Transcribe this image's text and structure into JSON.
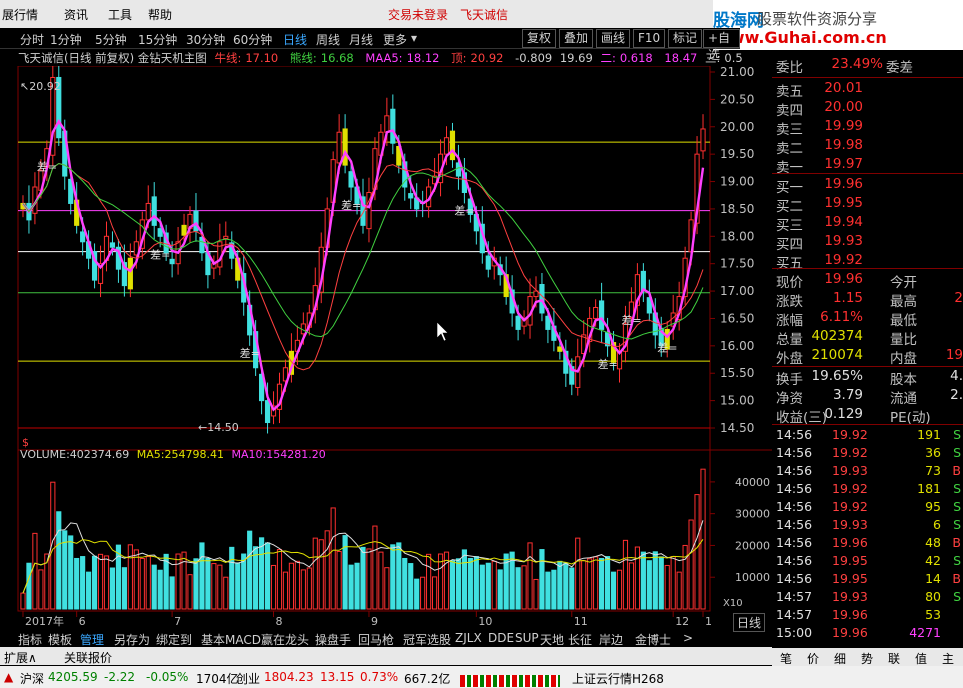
{
  "menubar": {
    "items": [
      "展行情",
      "资讯",
      "工具",
      "帮助"
    ],
    "login": "交易未登录",
    "stock": "飞天诚信",
    "corner_btn": "行"
  },
  "watermark": {
    "brand_cn": "股海网",
    "slogan": "股票软件资源分享",
    "url": "www.Guhai.com.cn"
  },
  "periods": [
    "分时",
    "1分钟",
    "5分钟",
    "15分钟",
    "30分钟",
    "60分钟",
    "日线",
    "周线",
    "月线",
    "更多"
  ],
  "active_period": "日线",
  "tools": [
    "复权",
    "叠加",
    "画线",
    "F10",
    "标记",
    "+自选"
  ],
  "chart_header": {
    "title": "飞天诚信(日线 前复权) 金钻天机主图",
    "n1_label": "牛线:",
    "n1": "17.10",
    "n2_label": "熊线:",
    "n2": "16.68",
    "maa5_label": "MAA5:",
    "maa5": "18.12",
    "top_label": "顶:",
    "top": "20.92",
    "v1": "-0.809",
    "v2": "19.69",
    "er_label": "二:",
    "er": "0.618",
    "v3": "18.47",
    "san_label": "三:",
    "san": "0.5"
  },
  "chart_data": {
    "type": "candlestick",
    "title": "飞天诚信(日线 前复权) 金钻天机主图",
    "ylim": [
      14.5,
      21.0
    ],
    "y_ticks": [
      "21.00",
      "20.50",
      "20.00",
      "19.50",
      "19.00",
      "18.50",
      "18.00",
      "17.50",
      "17.00",
      "16.50",
      "16.00",
      "15.50",
      "15.00",
      "14.50"
    ],
    "x_labels": [
      "2017年",
      "6",
      "7",
      "8",
      "9",
      "10",
      "11",
      "12",
      "1"
    ],
    "high_marker": "20.92",
    "low_marker": "14.50",
    "markers_label": "差=",
    "horizontal_levels": [
      {
        "value": 19.72,
        "color": "#e0e000"
      },
      {
        "value": 18.47,
        "color": "#ff40ff"
      },
      {
        "value": 17.72,
        "color": "#ffffff"
      },
      {
        "value": 16.97,
        "color": "#40c040"
      },
      {
        "value": 15.72,
        "color": "#e0e000"
      },
      {
        "value": 14.5,
        "color": "#c00000"
      }
    ],
    "close_series": [
      18.6,
      18.3,
      18.9,
      19.2,
      19.6,
      20.9,
      19.8,
      19.1,
      18.6,
      18.2,
      17.9,
      17.6,
      17.2,
      17.5,
      18.0,
      17.8,
      17.4,
      17.1,
      17.6,
      17.9,
      18.3,
      18.6,
      18.2,
      18.0,
      17.7,
      17.5,
      17.9,
      18.2,
      18.4,
      18.1,
      17.7,
      17.3,
      17.5,
      17.9,
      18.0,
      17.6,
      17.2,
      16.8,
      16.2,
      15.6,
      15.0,
      14.6,
      14.9,
      15.3,
      15.6,
      15.9,
      16.1,
      16.4,
      16.6,
      17.1,
      17.8,
      18.5,
      19.4,
      19.9,
      19.3,
      18.9,
      18.6,
      18.2,
      18.8,
      19.6,
      19.9,
      20.2,
      19.7,
      19.3,
      18.9,
      18.7,
      18.5,
      18.6,
      18.9,
      19.1,
      19.5,
      19.8,
      19.4,
      19.1,
      18.8,
      18.4,
      18.1,
      17.7,
      17.4,
      17.6,
      17.3,
      16.9,
      16.6,
      16.3,
      16.5,
      16.9,
      17.0,
      16.6,
      16.3,
      16.1,
      15.9,
      15.5,
      15.3,
      15.8,
      16.2,
      16.5,
      16.7,
      16.3,
      16.0,
      15.7,
      15.9,
      16.4,
      16.8,
      17.3,
      17.0,
      16.6,
      16.2,
      16.0,
      16.3,
      16.6,
      16.9,
      17.6,
      18.3,
      19.5,
      19.96
    ],
    "volume_header": {
      "label": "VOLUME:",
      "value": "402374.69",
      "ma5_label": "MA5:",
      "ma5": "254798.41",
      "ma10_label": "MA10:",
      "ma10": "154281.20"
    },
    "volume_ylim": [
      0,
      45000
    ],
    "volume_ticks": [
      "40000",
      "30000",
      "20000",
      "10000"
    ],
    "volume_unit": "X10"
  },
  "right_panel": {
    "weibi_label": "委比",
    "weibi": "23.49%",
    "weicha_label": "委差",
    "sell": [
      {
        "label": "卖五",
        "price": "20.01"
      },
      {
        "label": "卖四",
        "price": "20.00"
      },
      {
        "label": "卖三",
        "price": "19.99"
      },
      {
        "label": "卖二",
        "price": "19.98"
      },
      {
        "label": "卖一",
        "price": "19.97"
      }
    ],
    "buy": [
      {
        "label": "买一",
        "price": "19.96"
      },
      {
        "label": "买二",
        "price": "19.95"
      },
      {
        "label": "买三",
        "price": "19.94"
      },
      {
        "label": "买四",
        "price": "19.93"
      },
      {
        "label": "买五",
        "price": "19.92"
      }
    ],
    "stats": [
      {
        "l": "现价",
        "v": "19.96",
        "l2": "今开",
        "v2": ""
      },
      {
        "l": "涨跌",
        "v": "1.15",
        "l2": "最高",
        "v2": "2"
      },
      {
        "l": "涨幅",
        "v": "6.11%",
        "l2": "最低",
        "v2": ""
      },
      {
        "l": "总量",
        "v": "402374",
        "l2": "量比",
        "v2": ""
      },
      {
        "l": "外盘",
        "v": "210074",
        "l2": "内盘",
        "v2": "19"
      }
    ],
    "stats2": [
      {
        "l": "换手",
        "v": "19.65%",
        "l2": "股本",
        "v2": "4."
      },
      {
        "l": "净资",
        "v": "3.79",
        "l2": "流通",
        "v2": "2."
      },
      {
        "l": "收益(三)",
        "v": "0.129",
        "l2": "PE(动)",
        "v2": ""
      }
    ],
    "ticks": [
      {
        "t": "14:56",
        "p": "19.92",
        "n": "191",
        "d": "S"
      },
      {
        "t": "14:56",
        "p": "19.92",
        "n": "36",
        "d": "S"
      },
      {
        "t": "14:56",
        "p": "19.93",
        "n": "73",
        "d": "B"
      },
      {
        "t": "14:56",
        "p": "19.92",
        "n": "181",
        "d": "S"
      },
      {
        "t": "14:56",
        "p": "19.92",
        "n": "95",
        "d": "S"
      },
      {
        "t": "14:56",
        "p": "19.93",
        "n": "6",
        "d": "S"
      },
      {
        "t": "14:56",
        "p": "19.96",
        "n": "48",
        "d": "B"
      },
      {
        "t": "14:56",
        "p": "19.95",
        "n": "42",
        "d": "S"
      },
      {
        "t": "14:56",
        "p": "19.95",
        "n": "14",
        "d": "B"
      },
      {
        "t": "14:57",
        "p": "19.93",
        "n": "80",
        "d": "S"
      },
      {
        "t": "14:57",
        "p": "19.96",
        "n": "53",
        "d": ""
      },
      {
        "t": "15:00",
        "p": "19.96",
        "n": "4271",
        "d": ""
      }
    ],
    "tabs": [
      "笔",
      "价",
      "细",
      "势",
      "联",
      "值",
      "主"
    ]
  },
  "bottom_tabs": [
    "指标",
    "模板",
    "管理",
    "另存为",
    "绑定到",
    "基本MACD",
    "赢在龙头",
    "操盘手",
    "回马枪",
    "冠军选股",
    "ZJLX",
    "DDE",
    "SUP",
    "天地",
    "长征",
    "岸边",
    "金博士",
    ">"
  ],
  "active_bottom_tab": "管理",
  "period_label_right": "日线",
  "sub_tabs": [
    "扩展∧",
    "关联报价"
  ],
  "status": {
    "sh_label": "沪深",
    "sh": "4205.59",
    "sh_chg": "-2.22",
    "sh_pct": "-0.05%",
    "sh_amt": "1704亿",
    "cy_label": "创业",
    "cy": "1804.23",
    "cy_chg": "13.15",
    "cy_pct": "0.73%",
    "cy_amt": "667.2亿",
    "feed": "上证云行情H268"
  }
}
